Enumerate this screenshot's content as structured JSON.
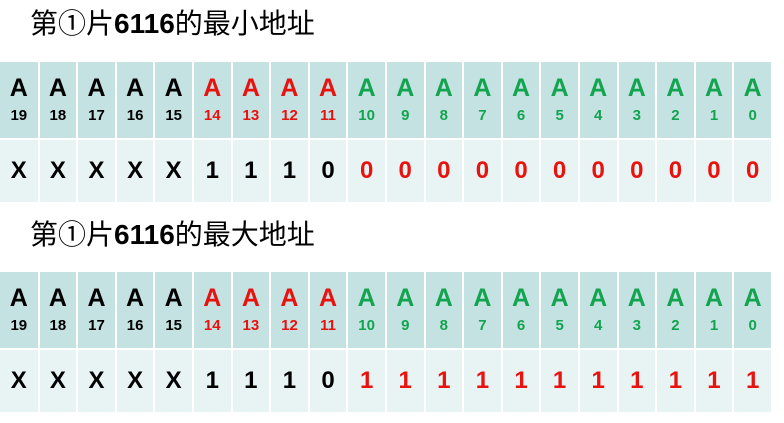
{
  "colors": {
    "black": "#000000",
    "red": "#e8120f",
    "green": "#13a44f",
    "header_bg": "#c5e2e2",
    "row_bg": "#e8f3f3"
  },
  "pins": [
    {
      "letter": "A",
      "num": "19",
      "color": "black"
    },
    {
      "letter": "A",
      "num": "18",
      "color": "black"
    },
    {
      "letter": "A",
      "num": "17",
      "color": "black"
    },
    {
      "letter": "A",
      "num": "16",
      "color": "black"
    },
    {
      "letter": "A",
      "num": "15",
      "color": "black"
    },
    {
      "letter": "A",
      "num": "14",
      "color": "red"
    },
    {
      "letter": "A",
      "num": "13",
      "color": "red"
    },
    {
      "letter": "A",
      "num": "12",
      "color": "red"
    },
    {
      "letter": "A",
      "num": "11",
      "color": "red"
    },
    {
      "letter": "A",
      "num": "10",
      "color": "green"
    },
    {
      "letter": "A",
      "num": "9",
      "color": "green"
    },
    {
      "letter": "A",
      "num": "8",
      "color": "green"
    },
    {
      "letter": "A",
      "num": "7",
      "color": "green"
    },
    {
      "letter": "A",
      "num": "6",
      "color": "green"
    },
    {
      "letter": "A",
      "num": "5",
      "color": "green"
    },
    {
      "letter": "A",
      "num": "4",
      "color": "green"
    },
    {
      "letter": "A",
      "num": "3",
      "color": "green"
    },
    {
      "letter": "A",
      "num": "2",
      "color": "green"
    },
    {
      "letter": "A",
      "num": "1",
      "color": "green"
    },
    {
      "letter": "A",
      "num": "0",
      "color": "green"
    }
  ],
  "sections": [
    {
      "title_prefix": "第①片",
      "title_chip": "6116",
      "title_suffix": "的最小地址",
      "values": [
        {
          "v": "X",
          "color": "black"
        },
        {
          "v": "X",
          "color": "black"
        },
        {
          "v": "X",
          "color": "black"
        },
        {
          "v": "X",
          "color": "black"
        },
        {
          "v": "X",
          "color": "black"
        },
        {
          "v": "1",
          "color": "black"
        },
        {
          "v": "1",
          "color": "black"
        },
        {
          "v": "1",
          "color": "black"
        },
        {
          "v": "0",
          "color": "black"
        },
        {
          "v": "0",
          "color": "red"
        },
        {
          "v": "0",
          "color": "red"
        },
        {
          "v": "0",
          "color": "red"
        },
        {
          "v": "0",
          "color": "red"
        },
        {
          "v": "0",
          "color": "red"
        },
        {
          "v": "0",
          "color": "red"
        },
        {
          "v": "0",
          "color": "red"
        },
        {
          "v": "0",
          "color": "red"
        },
        {
          "v": "0",
          "color": "red"
        },
        {
          "v": "0",
          "color": "red"
        },
        {
          "v": "0",
          "color": "red"
        }
      ]
    },
    {
      "title_prefix": "第①片",
      "title_chip": "6116",
      "title_suffix": "的最大地址",
      "values": [
        {
          "v": "X",
          "color": "black"
        },
        {
          "v": "X",
          "color": "black"
        },
        {
          "v": "X",
          "color": "black"
        },
        {
          "v": "X",
          "color": "black"
        },
        {
          "v": "X",
          "color": "black"
        },
        {
          "v": "1",
          "color": "black"
        },
        {
          "v": "1",
          "color": "black"
        },
        {
          "v": "1",
          "color": "black"
        },
        {
          "v": "0",
          "color": "black"
        },
        {
          "v": "1",
          "color": "red"
        },
        {
          "v": "1",
          "color": "red"
        },
        {
          "v": "1",
          "color": "red"
        },
        {
          "v": "1",
          "color": "red"
        },
        {
          "v": "1",
          "color": "red"
        },
        {
          "v": "1",
          "color": "red"
        },
        {
          "v": "1",
          "color": "red"
        },
        {
          "v": "1",
          "color": "red"
        },
        {
          "v": "1",
          "color": "red"
        },
        {
          "v": "1",
          "color": "red"
        },
        {
          "v": "1",
          "color": "red"
        }
      ]
    }
  ]
}
